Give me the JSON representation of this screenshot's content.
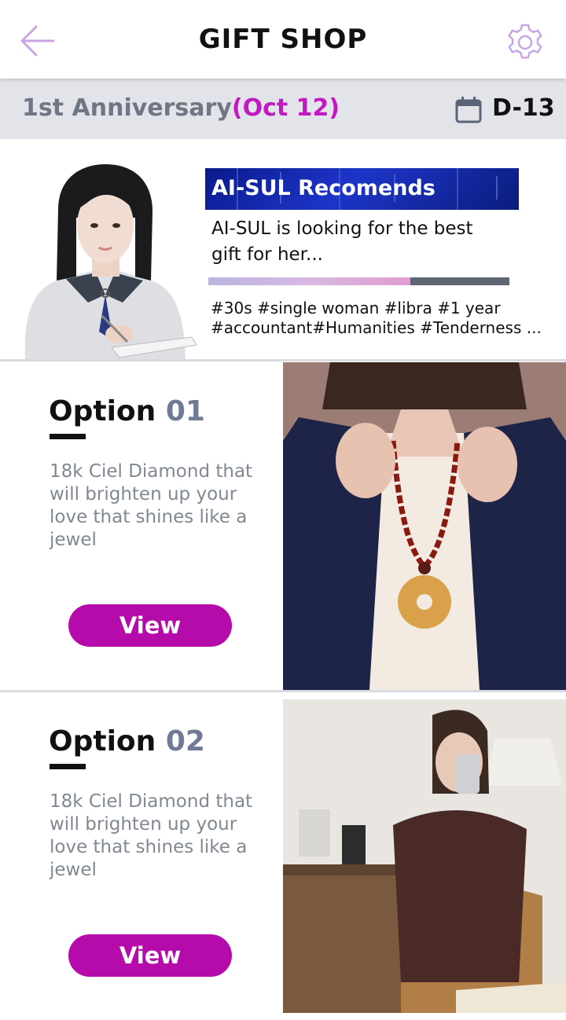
{
  "header": {
    "title": "GIFT SHOP",
    "back_icon": "back-arrow-icon",
    "settings_icon": "gear-icon",
    "accent_color": "#c8a6e6"
  },
  "anniversary": {
    "label": "1st Anniversary",
    "date": "(Oct 12)",
    "calendar_icon": "calendar-icon",
    "dday": "D-13",
    "accent_color": "#c11ac1"
  },
  "recommendation": {
    "title": "AI-SUL Recomends",
    "text": "AI-SUL is looking for the best gift for her...",
    "progress": 0.67,
    "tags": "#30s #single woman #libra #1 year #accountant#Humanities #Tenderness ..."
  },
  "options": [
    {
      "label": "Option",
      "number": "01",
      "description": "18k Ciel Diamond that will brighten up your love that shines like a jewel",
      "button": "View"
    },
    {
      "label": "Option",
      "number": "02",
      "description": "18k Ciel Diamond that will brighten up your love that shines like a jewel",
      "button": "View"
    }
  ],
  "colors": {
    "button": "#b60bab",
    "banner": "#1d35c8",
    "bar_bg": "#e2e4ea"
  }
}
